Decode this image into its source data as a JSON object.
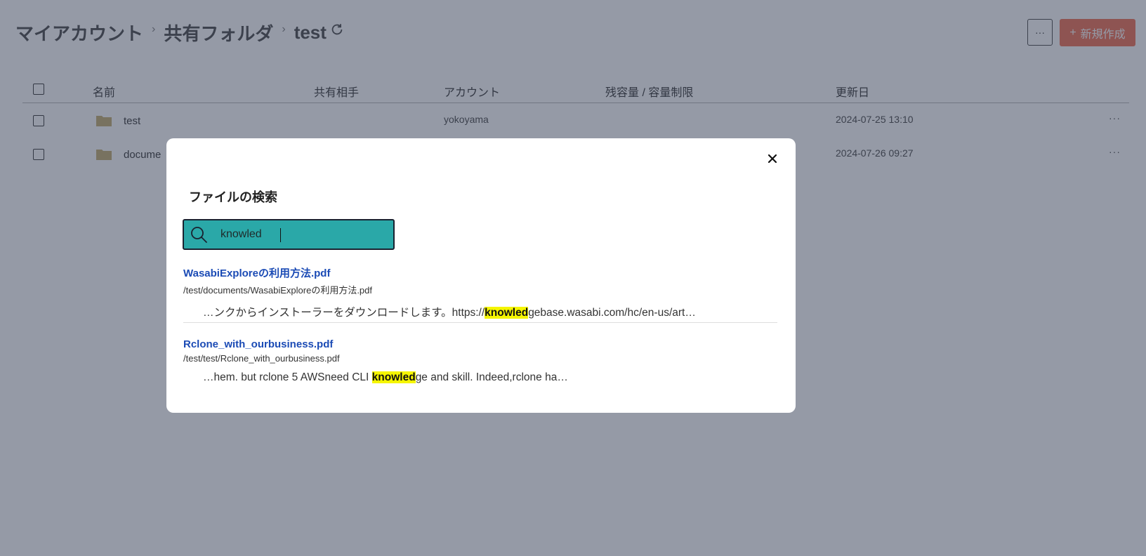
{
  "breadcrumb": {
    "items": [
      "マイアカウント",
      "共有フォルダ"
    ],
    "separator": "›",
    "current": "test"
  },
  "toolbar": {
    "more_label": "···",
    "create_label": "新規作成",
    "create_icon": "+"
  },
  "table": {
    "columns": [
      "名前",
      "共有相手",
      "アカウント",
      "残容量 / 容量制限",
      "更新日"
    ],
    "rows": [
      {
        "name": "test",
        "shared_with": "",
        "account": "yokoyama",
        "quota": "",
        "updated": "2024-07-25 13:10"
      },
      {
        "name": "docume",
        "shared_with": "",
        "account": "",
        "quota": "",
        "updated": "2024-07-26 09:27"
      }
    ],
    "row_more": "···"
  },
  "modal": {
    "title": "ファイルの検索",
    "close_icon": "close-icon",
    "search": {
      "value": "knowled",
      "placeholder": ""
    },
    "results": [
      {
        "title": "WasabiExploreの利用方法.pdf",
        "path": "/test/documents/WasabiExploreの利用方法.pdf",
        "snippet_before": "…ンクからインストーラーをダウンロードします。https://",
        "snippet_match": "knowled",
        "snippet_after": "gebase.wasabi.com/hc/en-us/art…"
      },
      {
        "title": "Rclone_with_ourbusiness.pdf",
        "path": "/test/test/Rclone_with_ourbusiness.pdf",
        "snippet_before": "…hem. but rclone 5 AWSneed CLI ",
        "snippet_match": "knowled",
        "snippet_after": "ge and skill. Indeed,rclone ha…"
      }
    ]
  },
  "colors": {
    "accent": "#2aa8a8",
    "create_button": "#f27a5e",
    "link": "#1b4bb5",
    "highlight": "#f5f500",
    "overlay": "#222c46"
  }
}
